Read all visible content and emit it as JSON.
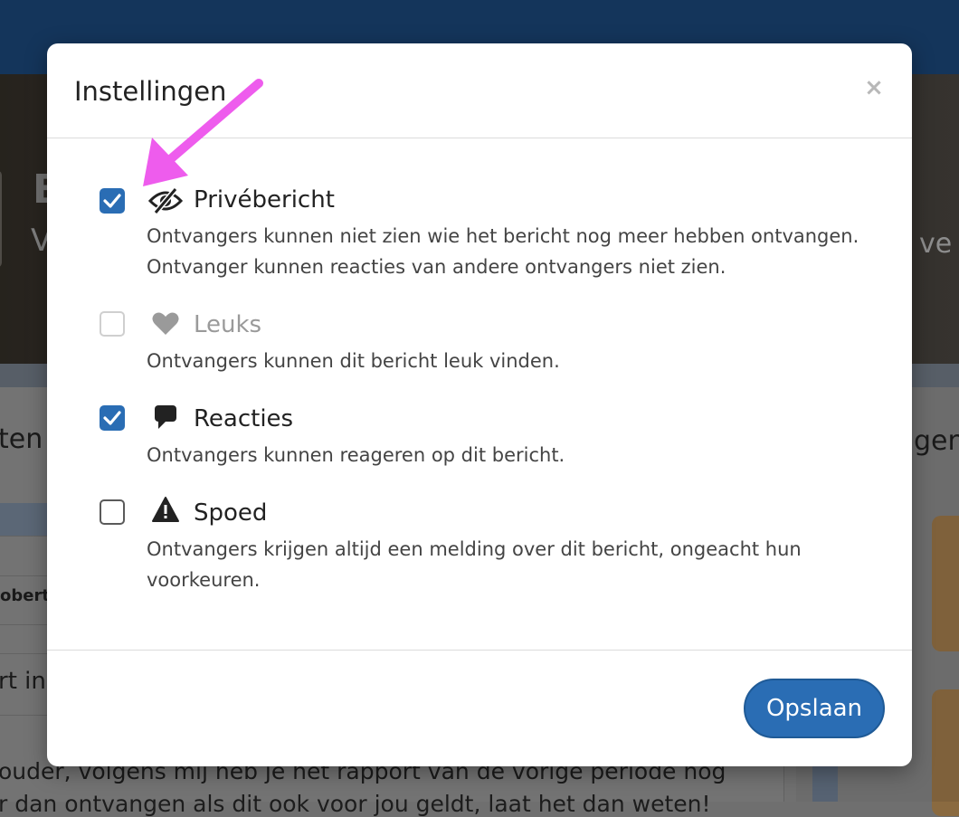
{
  "background": {
    "hero_initial": "B",
    "hero_subtitle_fragment": "V",
    "hero_right_fragment": "ve",
    "left_heading_fragment": "ten",
    "right_heading_fragment": "geno",
    "table_cell_fragment": "obert",
    "row_fragment": "rt in",
    "message_line1": "ouder, volgens mij heb je het rapport van de vorige periode nog",
    "message_line2": "r dan ontvangen als dit ook voor jou geldt, laat het dan weten!"
  },
  "modal": {
    "title": "Instellingen",
    "close_symbol": "×",
    "options": [
      {
        "label": "Privébericht",
        "icon": "eye-slash-icon",
        "checked": true,
        "disabled": false,
        "description_lines": [
          "Ontvangers kunnen niet zien wie het bericht nog meer hebben ontvangen.",
          "Ontvanger kunnen reacties van andere ontvangers niet zien."
        ]
      },
      {
        "label": "Leuks",
        "icon": "heart-icon",
        "checked": false,
        "disabled": true,
        "description_lines": [
          "Ontvangers kunnen dit bericht leuk vinden."
        ]
      },
      {
        "label": "Reacties",
        "icon": "comment-icon",
        "checked": true,
        "disabled": false,
        "description_lines": [
          "Ontvangers kunnen reageren op dit bericht."
        ]
      },
      {
        "label": "Spoed",
        "icon": "warning-icon",
        "checked": false,
        "disabled": false,
        "description_lines": [
          "Ontvangers krijgen altijd een melding over dit bericht, ongeacht hun",
          "voorkeuren."
        ]
      }
    ],
    "save_label": "Opslaan"
  },
  "colors": {
    "accent": "#2a6db4",
    "topbar": "#163a63",
    "annotation_arrow": "#ee5ced"
  }
}
